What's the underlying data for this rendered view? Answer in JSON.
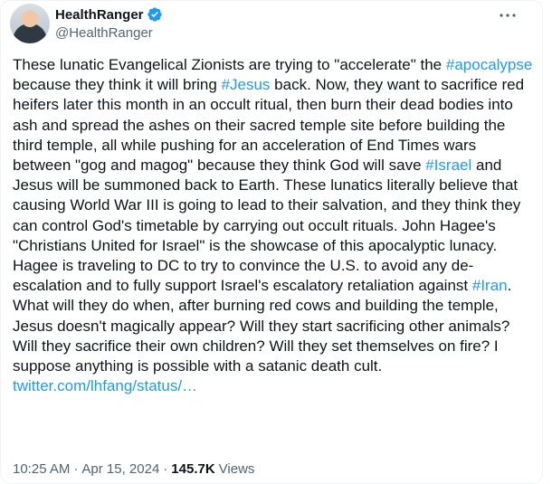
{
  "author": {
    "display_name": "HealthRanger",
    "handle": "@HealthRanger"
  },
  "tweet": {
    "segments": [
      {
        "text": "These lunatic Evangelical Zionists are trying to \"accelerate\" the ",
        "type": "text"
      },
      {
        "text": "#apocalypse",
        "type": "hashtag"
      },
      {
        "text": " because they think it will bring ",
        "type": "text"
      },
      {
        "text": "#Jesus",
        "type": "hashtag"
      },
      {
        "text": " back. Now, they want to sacrifice red heifers later this month in an occult ritual, then burn their dead bodies into ash and spread the ashes on their sacred temple site before building the third temple, all while pushing for an acceleration of End Times wars between \"gog and magog\" because they think God will save ",
        "type": "text"
      },
      {
        "text": "#Israel",
        "type": "hashtag"
      },
      {
        "text": " and Jesus will be summoned back to Earth. These lunatics literally believe that causing World War III is going to lead to their salvation, and they think they can control God's timetable by carrying out occult rituals. John Hagee's \"Christians United for Israel\" is the showcase of this apocalyptic lunacy. Hagee is traveling to DC to try to convince the U.S. to avoid any de-escalation and to fully support Israel's escalatory retaliation against ",
        "type": "text"
      },
      {
        "text": "#Iran",
        "type": "hashtag"
      },
      {
        "text": ". What will they do when, after burning red cows and building the temple, Jesus doesn't magically appear? Will they start sacrificing other animals? Will they sacrifice their own children? Will they set themselves on fire? I suppose anything is possible with a satanic death cult.",
        "type": "text"
      }
    ],
    "link": "twitter.com/lhfang/status/…",
    "time": "10:25 AM",
    "separator": "·",
    "date": "Apr 15, 2024",
    "views_count": "145.7K",
    "views_label": "Views"
  },
  "icons": {
    "verified": "verified-badge-icon",
    "more": "more-options-icon"
  },
  "colors": {
    "link": "#1d9bf0",
    "text": "#0f1419",
    "secondary": "#536471"
  }
}
